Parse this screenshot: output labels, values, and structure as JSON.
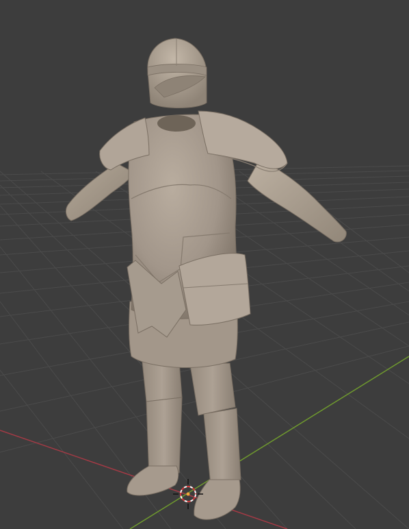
{
  "viewport": {
    "kind": "3d-viewport",
    "shading": "solid",
    "background_color": "#3d3d3d",
    "grid_color": "#4b4b4b",
    "x_axis_color": "#a33a45",
    "y_axis_color": "#6f9a2e",
    "model_color": "#a89b8c",
    "cursor": {
      "icon": "3d-cursor-icon",
      "ring_colors": [
        "#ffffff",
        "#d23a3a"
      ]
    },
    "object": {
      "icon": "armor-figure",
      "parts": [
        "helmet",
        "torso",
        "left-pauldron",
        "right-pauldron",
        "left-arm",
        "right-arm",
        "waist-tassets",
        "left-leg",
        "right-leg"
      ]
    }
  }
}
